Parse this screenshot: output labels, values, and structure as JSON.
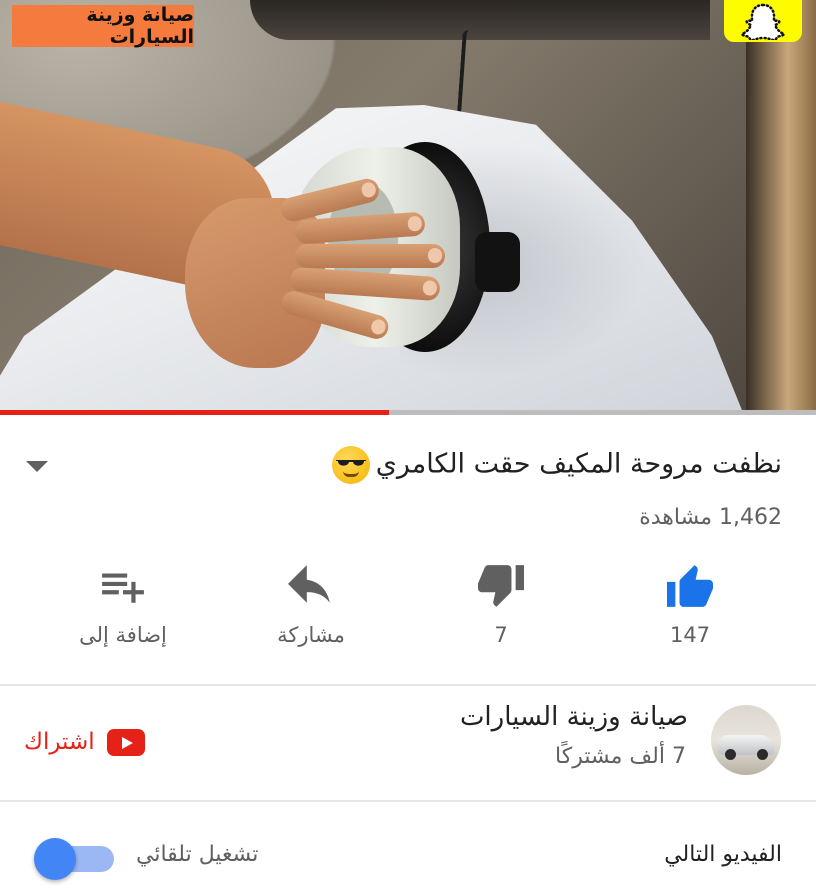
{
  "video": {
    "overlay_title": "صيانة وزينة السيارات",
    "progress": 0.477,
    "colors": {
      "progress_fill": "#e62117",
      "progress_track": "#bdbdbd",
      "overlay_bg": "#f47a3d"
    }
  },
  "info": {
    "title": "نظفت مروحة المكيف حقت الكامري",
    "title_emoji": "smiling-face-with-sunglasses",
    "views": "1,462 مشاهدة"
  },
  "actions": [
    {
      "name": "like",
      "icon": "thumbs-up-icon",
      "label": "147",
      "color": "#1a73e8"
    },
    {
      "name": "dislike",
      "icon": "thumbs-down-icon",
      "label": "7",
      "color": "#606060"
    },
    {
      "name": "share",
      "icon": "share-icon",
      "label": "مشاركة",
      "color": "#606060"
    },
    {
      "name": "add-to",
      "icon": "add-to-playlist-icon",
      "label": "إضافة إلى",
      "color": "#606060"
    }
  ],
  "channel": {
    "name": "صيانة وزينة السيارات",
    "subscribers": "7 ألف مشتركًا",
    "subscribe_label": "اشتراك",
    "subscribe_color": "#e62117"
  },
  "up_next": {
    "label": "الفيديو التالي",
    "autoplay_label": "تشغيل تلقائي",
    "autoplay_on": true
  }
}
